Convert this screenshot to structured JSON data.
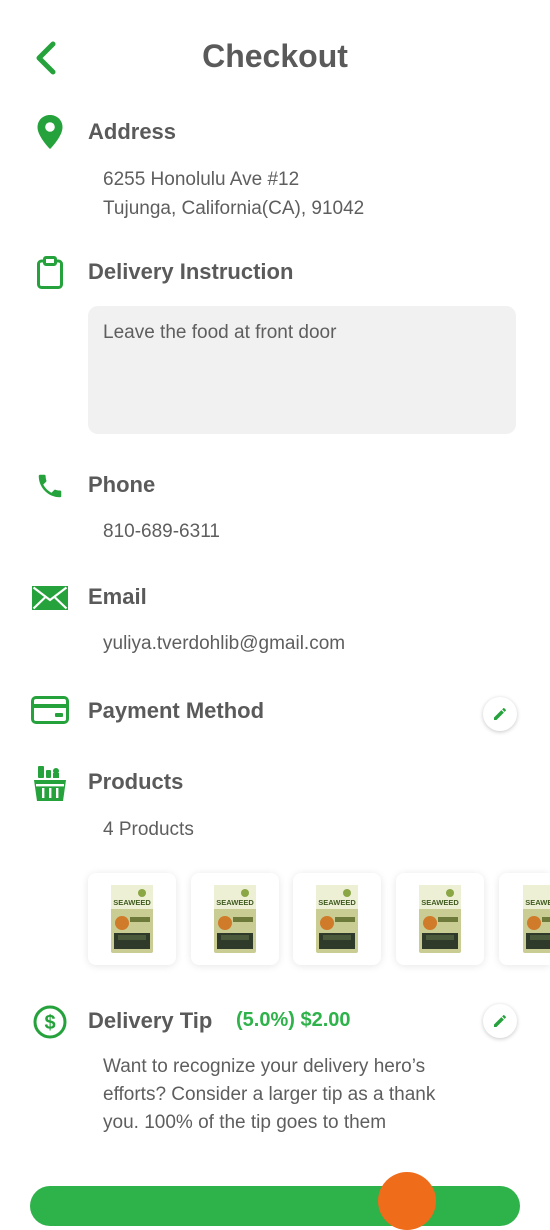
{
  "header": {
    "title": "Checkout"
  },
  "address": {
    "title": "Address",
    "line1": "6255 Honolulu Ave #12",
    "line2": "Tujunga, California(CA), 91042"
  },
  "delivery_instruction": {
    "title": "Delivery Instruction",
    "value": "Leave the food at front door"
  },
  "phone": {
    "title": "Phone",
    "value": "810-689-6311"
  },
  "email": {
    "title": "Email",
    "value": "yuliya.tverdohlib@gmail.com"
  },
  "payment": {
    "title": "Payment Method"
  },
  "products": {
    "title": "Products",
    "count_label": "4 Products",
    "items": [
      {
        "brand": "SEAWEED"
      },
      {
        "brand": "SEAWEED"
      },
      {
        "brand": "SEAWEED"
      },
      {
        "brand": "SEAWEED"
      },
      {
        "brand": "SEAWEED"
      }
    ]
  },
  "delivery_tip": {
    "title": "Delivery Tip",
    "amount": "(5.0%) $2.00",
    "line1": "Want to recognize your delivery hero’s",
    "line2": "efforts? Consider a larger tip as a thank",
    "line3": "you. 100% of the tip goes to them"
  },
  "colors": {
    "accent": "#25a23b",
    "tip_amount": "#2eb24a",
    "text": "#5a5a5a",
    "input_bg": "#f1f1f1",
    "badge": "#ef6c1a"
  },
  "icons": [
    "back-arrow-icon",
    "location-pin-icon",
    "clipboard-icon",
    "phone-icon",
    "envelope-icon",
    "credit-card-icon",
    "grocery-basket-icon",
    "dollar-circle-icon",
    "pencil-icon"
  ]
}
